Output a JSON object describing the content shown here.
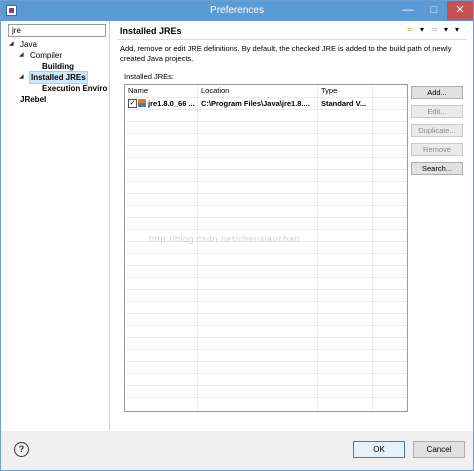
{
  "window": {
    "title": "Preferences"
  },
  "filter": {
    "value": "jre"
  },
  "tree": {
    "java": "Java",
    "compiler": "Compiler",
    "building": "Building",
    "installed_jres": "Installed JREs",
    "execution_env": "Execution Enviro",
    "jrebel": "JRebel"
  },
  "page": {
    "title": "Installed JREs",
    "description": "Add, remove or edit JRE definitions. By default, the checked JRE is added to the build path of newly created Java projects.",
    "list_label": "Installed JREs:"
  },
  "table": {
    "headers": [
      "Name",
      "Location",
      "Type"
    ],
    "rows": [
      {
        "name": "jre1.8.0_66 ...",
        "location": "C:\\Program Files\\Java\\jre1.8....",
        "type": "Standard V...",
        "checked": true
      }
    ]
  },
  "buttons": {
    "add": "Add...",
    "edit": "Edit...",
    "duplicate": "Duplicate...",
    "remove": "Remove",
    "search": "Search...",
    "ok": "OK",
    "cancel": "Cancel"
  },
  "watermark": "http://blog.csdn.net/chenxiaochan",
  "colors": {
    "titlebar": "#5b9bd5",
    "selection": "#cce8ff"
  }
}
